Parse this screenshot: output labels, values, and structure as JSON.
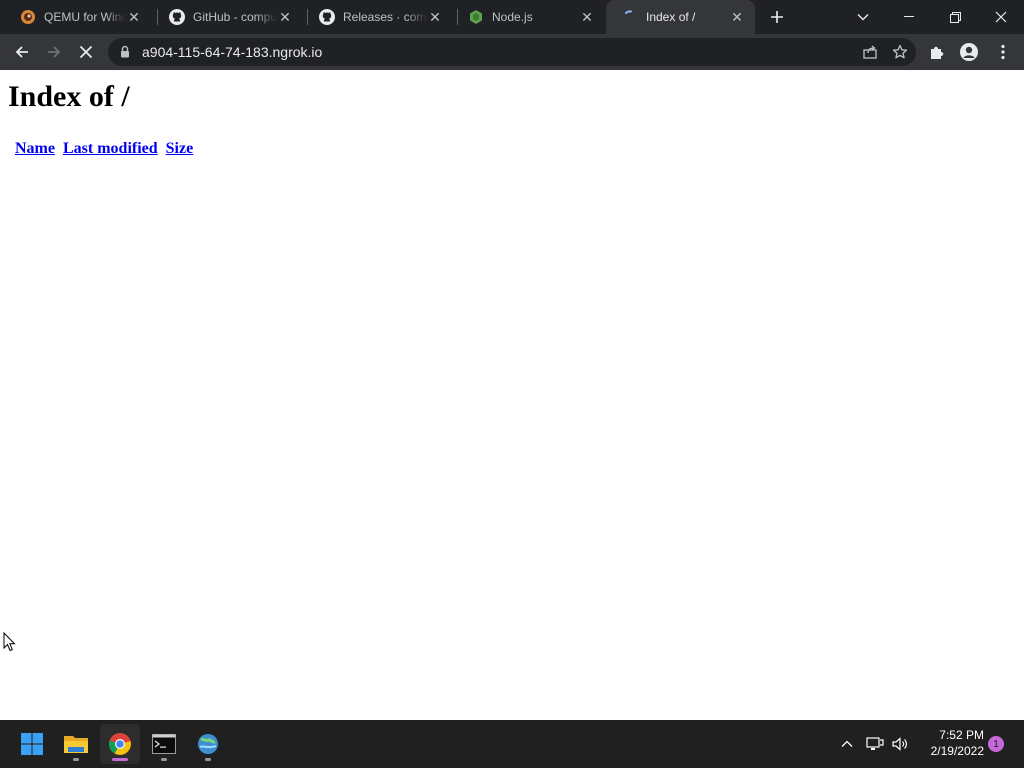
{
  "browser": {
    "tabs": [
      {
        "title": "QEMU for Windows",
        "favicon": "qemu-icon",
        "active": false
      },
      {
        "title": "GitHub - compu",
        "favicon": "github-icon",
        "active": false
      },
      {
        "title": "Releases · comp",
        "favicon": "github-icon",
        "active": false
      },
      {
        "title": "Node.js",
        "favicon": "nodejs-icon",
        "active": false
      },
      {
        "title": "Index of /",
        "favicon": "loading-spinner-icon",
        "active": true
      }
    ],
    "url": "a904-115-64-74-183.ngrok.io",
    "loading": true
  },
  "page": {
    "heading": "Index of /",
    "columns": [
      "Name",
      "Last modified",
      "Size"
    ]
  },
  "taskbar": {
    "apps": [
      "windows-start-icon",
      "file-explorer-icon",
      "chrome-icon",
      "terminal-icon",
      "network-globe-icon"
    ],
    "time": "7:52 PM",
    "date": "2/19/2022",
    "notification_count": "1"
  },
  "colors": {
    "tabstrip_bg": "#202124",
    "toolbar_bg": "#35363a",
    "omnibox_bg": "#202124",
    "link": "#0000ee",
    "taskbar_bg": "#202020",
    "accent": "#c46ad8"
  }
}
